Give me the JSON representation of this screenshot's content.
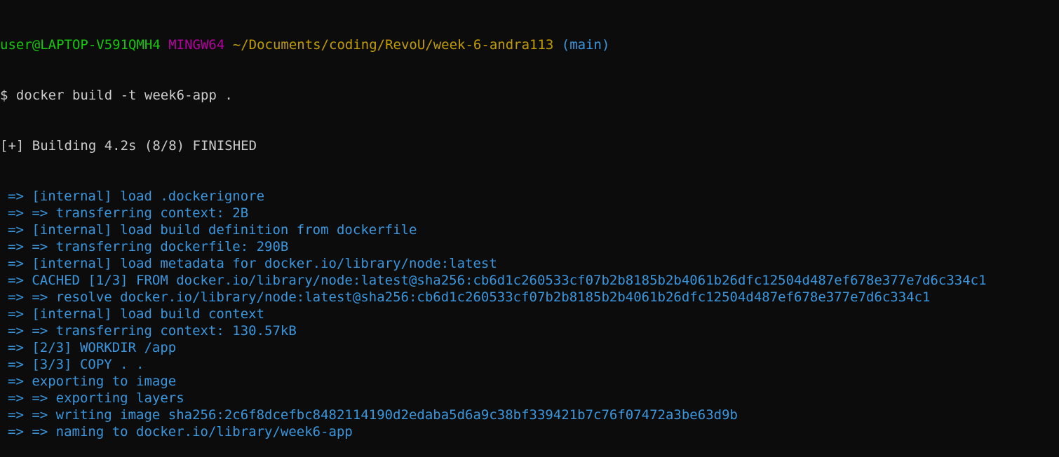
{
  "prompt": {
    "user_host": "user@LAPTOP-V591QMH4",
    "shell": "MINGW64",
    "path": "~/Documents/coding/RevoU/week-6-andra113",
    "branch": "(main)",
    "symbol": "$",
    "command": "docker build -t week6-app ."
  },
  "status_line": "[+] Building 4.2s (8/8) FINISHED",
  "build_steps": [
    "=> [internal] load .dockerignore",
    "=> => transferring context: 2B",
    "=> [internal] load build definition from dockerfile",
    "=> => transferring dockerfile: 290B",
    "=> [internal] load metadata for docker.io/library/node:latest",
    "=> CACHED [1/3] FROM docker.io/library/node:latest@sha256:cb6d1c260533cf07b2b8185b2b4061b26dfc12504d487ef678e377e7d6c334c1",
    "=> => resolve docker.io/library/node:latest@sha256:cb6d1c260533cf07b2b8185b2b4061b26dfc12504d487ef678e377e7d6c334c1",
    "=> [internal] load build context",
    "=> => transferring context: 130.57kB",
    "=> [2/3] WORKDIR /app",
    "=> [3/3] COPY . .",
    "=> exporting to image",
    "=> => exporting layers",
    "=> => writing image sha256:2c6f8dcefbc8482114190d2edaba5d6a9c38bf339421b7c76f07472a3be63d9b",
    "=> => naming to docker.io/library/week6-app"
  ],
  "colors": {
    "background": "#0c0c0c",
    "user_host": "#16c60c",
    "shell": "#b4009e",
    "path": "#c19c00",
    "branch": "#3a96dd",
    "default_text": "#cccccc",
    "build_step": "#3a96dd"
  }
}
